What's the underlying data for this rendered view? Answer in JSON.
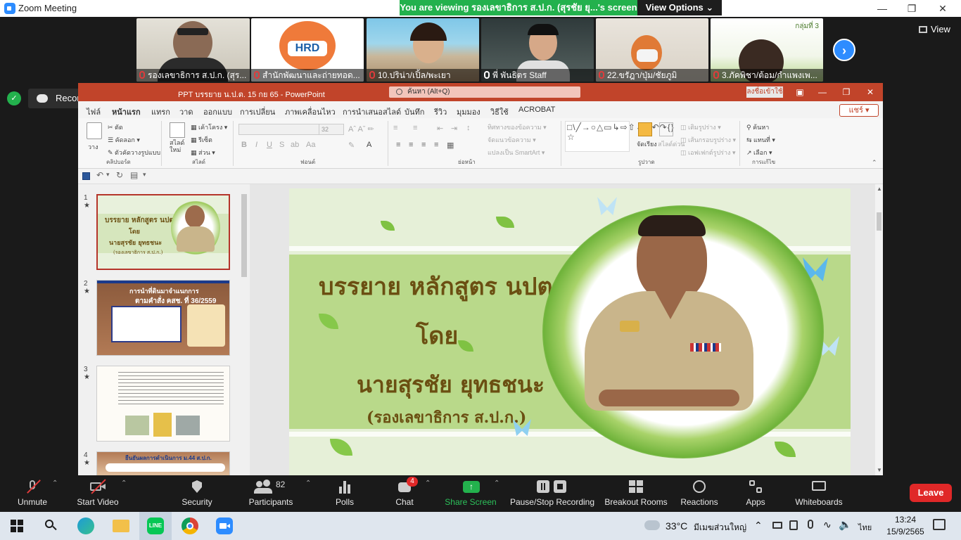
{
  "zoom": {
    "window_title": "Zoom Meeting",
    "viewing_banner": "You are viewing รองเลขาธิการ ส.ป.ก. (สุรชัย ยุ...'s screen",
    "view_options": "View Options",
    "view_label": "View",
    "recording_label": "Recording...",
    "participants_strip": [
      {
        "name": "รองเลขาธิการ ส.ป.ก. (สุร..."
      },
      {
        "name": "สำนักพัฒนาและถ่ายทอด..."
      },
      {
        "name": "10.ปริน่า/เปิ้ล/พะเยา"
      },
      {
        "name": "พี่ พันธิตร Staff"
      },
      {
        "name": "22.ขรัฎา/ปุ่ม/ชัยภูมิ"
      },
      {
        "name": "3.ภัคพิชา/ต้อม/กำแพงเพ..."
      }
    ],
    "group_tag": "กลุ่มที่ 3",
    "hrd_logo_text": "HRD",
    "toolbar": {
      "unmute": "Unmute",
      "start_video": "Start Video",
      "security": "Security",
      "participants": "Participants",
      "participants_count": "82",
      "polls": "Polls",
      "chat": "Chat",
      "chat_badge": "4",
      "share_screen": "Share Screen",
      "pause_stop_recording": "Pause/Stop Recording",
      "breakout_rooms": "Breakout Rooms",
      "reactions": "Reactions",
      "apps": "Apps",
      "whiteboards": "Whiteboards",
      "leave": "Leave"
    }
  },
  "ppt": {
    "title": "PPT บรรยาย น.ป.ต.  15 กย 65  -  PowerPoint",
    "search_placeholder": "ค้นหา (Alt+Q)",
    "signin": "ลงชื่อเข้าใช้",
    "share": "แชร์",
    "tabs": [
      "ไฟล์",
      "หน้าแรก",
      "แทรก",
      "วาด",
      "ออกแบบ",
      "การเปลี่ยน",
      "ภาพเคลื่อนไหว",
      "การนำเสนอสไลด์",
      "บันทึก",
      "รีวิว",
      "มุมมอง",
      "วิธีใช้",
      "ACROBAT"
    ],
    "active_tab": "หน้าแรก",
    "ribbon": {
      "clipboard_label": "คลิปบอร์ด",
      "paste": "วาง",
      "cut": "ตัด",
      "copy": "คัดลอก",
      "format_painter": "ตัวคัดวางรูปแบบ",
      "slides_label": "สไลด์",
      "new_slide": "สไลด์ใหม่",
      "layout": "เค้าโครง",
      "reset": "รีเซ็ต",
      "section": "ส่วน",
      "font_label": "ฟอนต์",
      "font_size": "32",
      "paragraph_label": "ย่อหน้า",
      "text_direction": "ทิศทางของข้อความ",
      "align_text": "จัดแนวข้อความ",
      "convert_smartart": "แปลงเป็น SmartArt",
      "drawing_label": "รูปวาด",
      "arrange": "จัดเรียง",
      "quick_styles": "สไลด์ด่วน",
      "shape_fill": "เติมรูปร่าง",
      "shape_outline": "เส้นกรอบรูปร่าง",
      "shape_effects": "เอฟเฟกต์รูปร่าง",
      "editing_label": "การแก้ไข",
      "find": "ค้นหา",
      "replace": "แทนที่",
      "select": "เลือก"
    },
    "slide_numbers": [
      "1",
      "2",
      "3",
      "4"
    ],
    "thumb2_title": "การนำที่ดินมาจำแนกการ",
    "thumb2_subtitle": "ตามคำสั่ง คสช. ที่ 36/2559",
    "thumb4_title": "ยืนยันผลการดำเนินการ ม.44 ส.ป.ก.",
    "slide": {
      "line1": "บรรยาย หลักสูตร นปต.",
      "line2": "โดย",
      "line3": "นายสุรชัย  ยุทธชนะ",
      "line4": "(รองเลขาธิการ ส.ป.ก.)"
    }
  },
  "taskbar": {
    "temperature": "33°C",
    "weather": "มีเมฆส่วนใหญ่",
    "language": "ไทย",
    "time": "13:24",
    "date": "15/9/2565"
  }
}
